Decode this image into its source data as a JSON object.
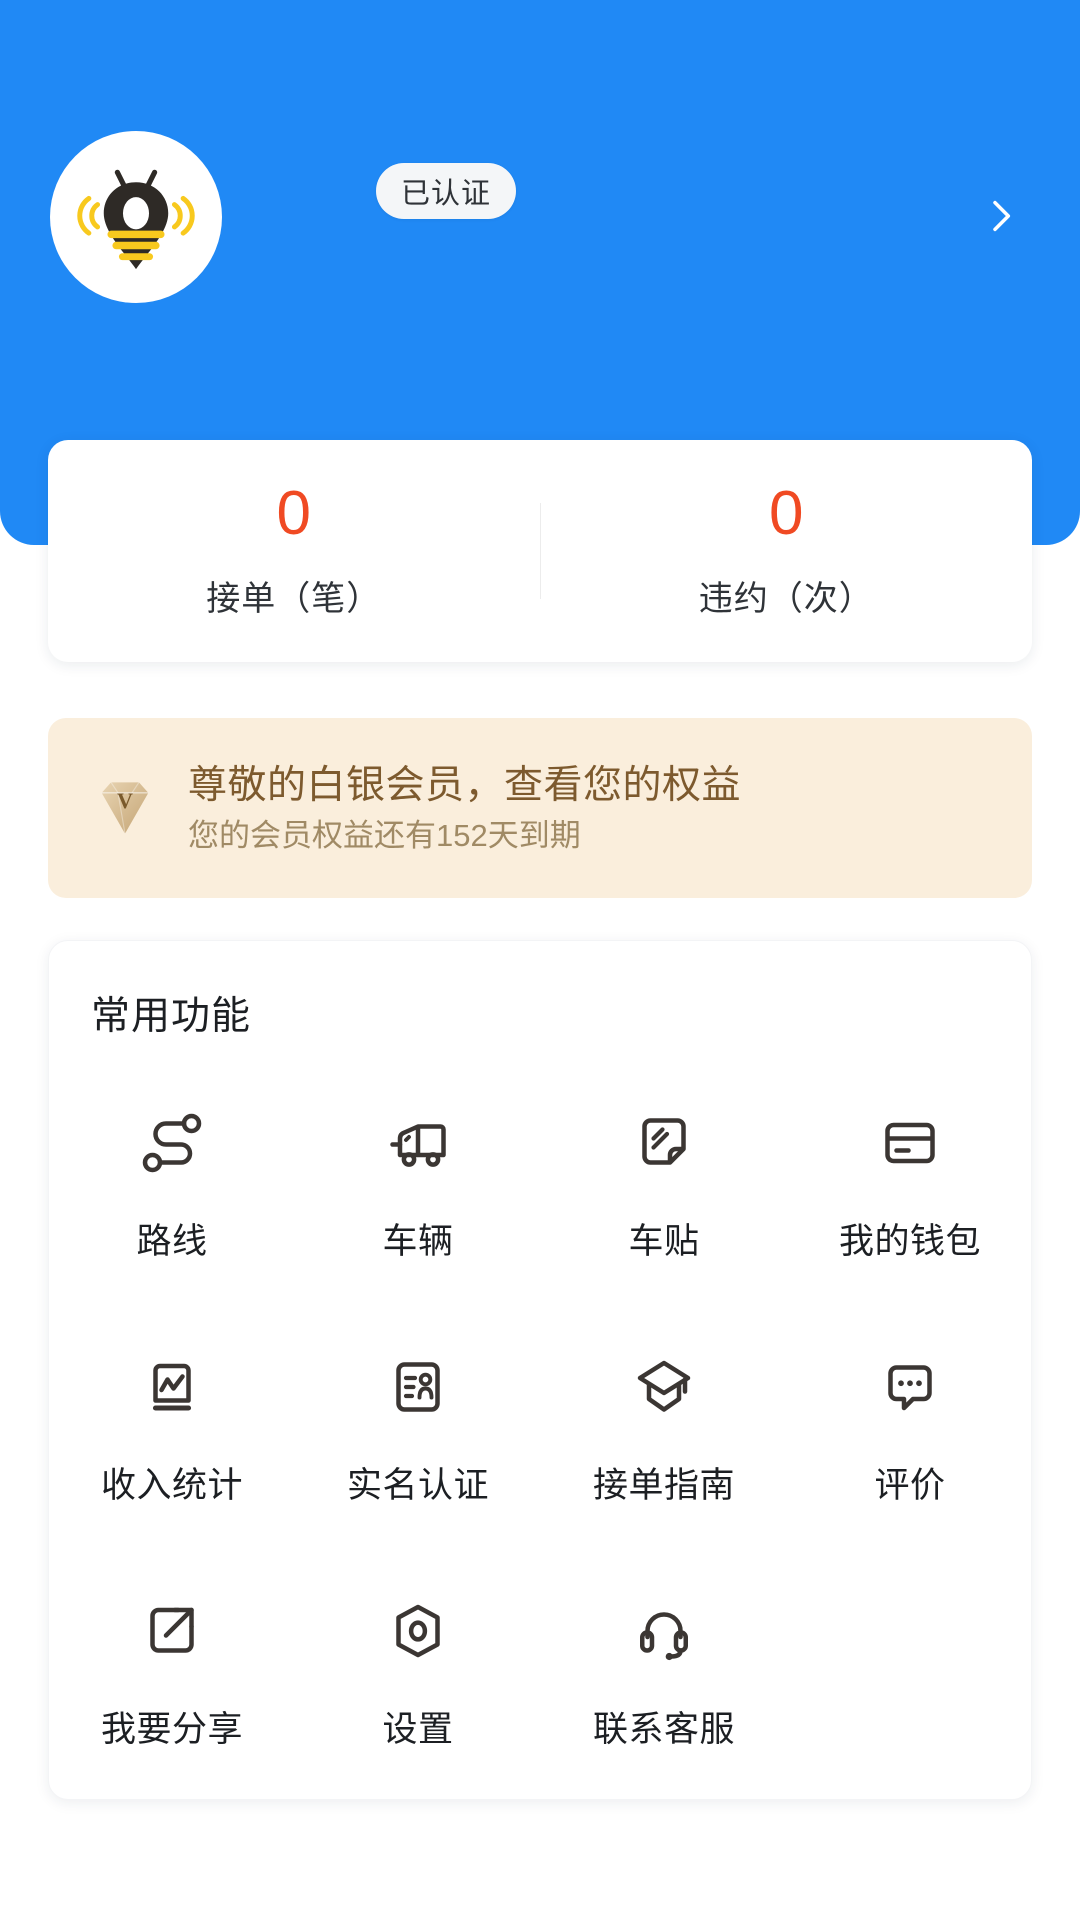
{
  "header": {
    "background_color": "#2089f5",
    "avatar_icon": "bee-location-pin-logo",
    "verify_badge_label": "已认证",
    "chevron_icon": "chevron-right-icon"
  },
  "stats": {
    "accent_color": "#f04a23",
    "items": [
      {
        "value": "0",
        "label": "接单（笔）"
      },
      {
        "value": "0",
        "label": "违约（次）"
      }
    ]
  },
  "membership": {
    "background_color": "#faeedc",
    "badge_icon": "diamond-gem-icon",
    "badge_letter": "V",
    "title": "尊敬的白银会员，查看您的权益",
    "subtitle": "您的会员权益还有152天到期"
  },
  "functions": {
    "title": "常用功能",
    "items": [
      {
        "label": "路线",
        "icon": "route-icon"
      },
      {
        "label": "车辆",
        "icon": "truck-icon"
      },
      {
        "label": "车贴",
        "icon": "vehicle-sticker-icon"
      },
      {
        "label": "我的钱包",
        "icon": "wallet-card-icon"
      },
      {
        "label": "收入统计",
        "icon": "income-chart-icon"
      },
      {
        "label": "实名认证",
        "icon": "id-card-icon"
      },
      {
        "label": "接单指南",
        "icon": "graduation-cap-icon"
      },
      {
        "label": "评价",
        "icon": "comment-dots-icon"
      },
      {
        "label": "我要分享",
        "icon": "share-external-icon"
      },
      {
        "label": "设置",
        "icon": "settings-hexagon-icon"
      },
      {
        "label": "联系客服",
        "icon": "headset-icon"
      }
    ]
  }
}
